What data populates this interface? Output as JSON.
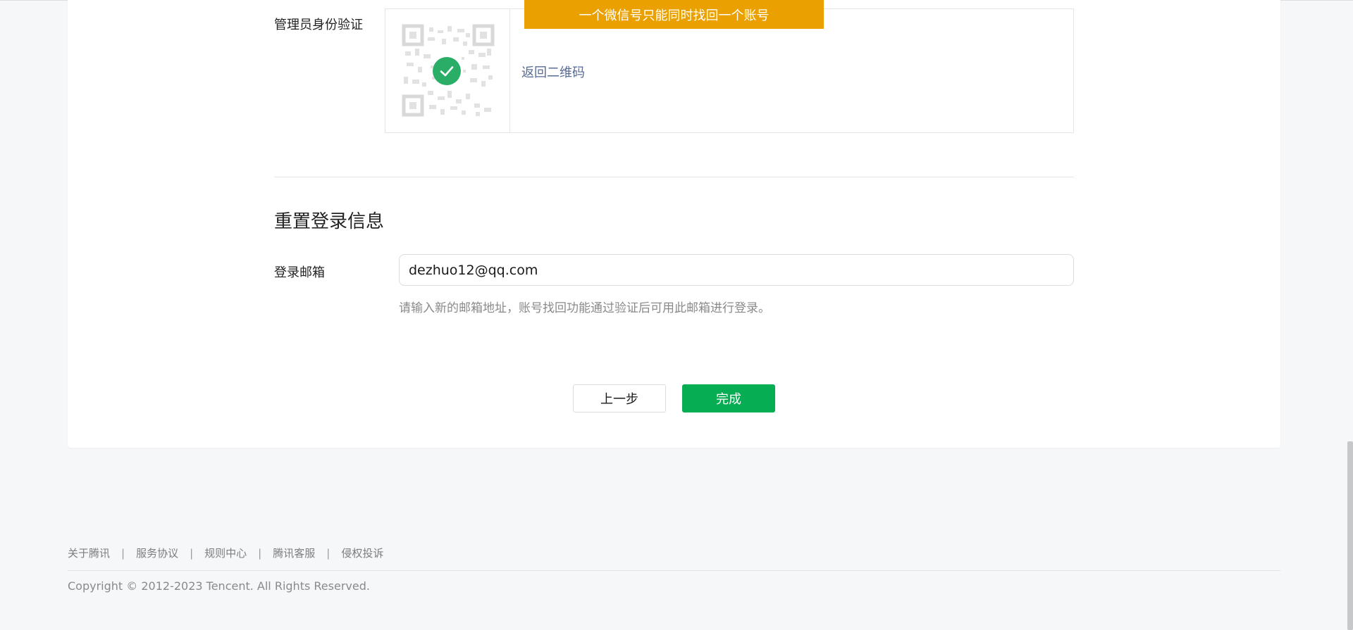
{
  "verify": {
    "label": "管理员身份验证",
    "banner": "一个微信号只能同时找回一个账号",
    "back_link": "返回二维码"
  },
  "reset": {
    "title": "重置登录信息",
    "email_label": "登录邮箱",
    "email_value": "dezhuo12@qq.com",
    "hint": "请输入新的邮箱地址，账号找回功能通过验证后可用此邮箱进行登录。"
  },
  "buttons": {
    "prev": "上一步",
    "done": "完成"
  },
  "footer": {
    "links": [
      "关于腾讯",
      "服务协议",
      "规则中心",
      "腾讯客服",
      "侵权投诉"
    ],
    "copyright": "Copyright © 2012-2023 Tencent. All Rights Reserved."
  },
  "colors": {
    "banner": "#eaa000",
    "primary_button": "#07ad52",
    "link": "#576b95",
    "check": "#2aae67"
  },
  "icons": {
    "qr": "qr-code-icon",
    "check": "check-circle-icon"
  }
}
